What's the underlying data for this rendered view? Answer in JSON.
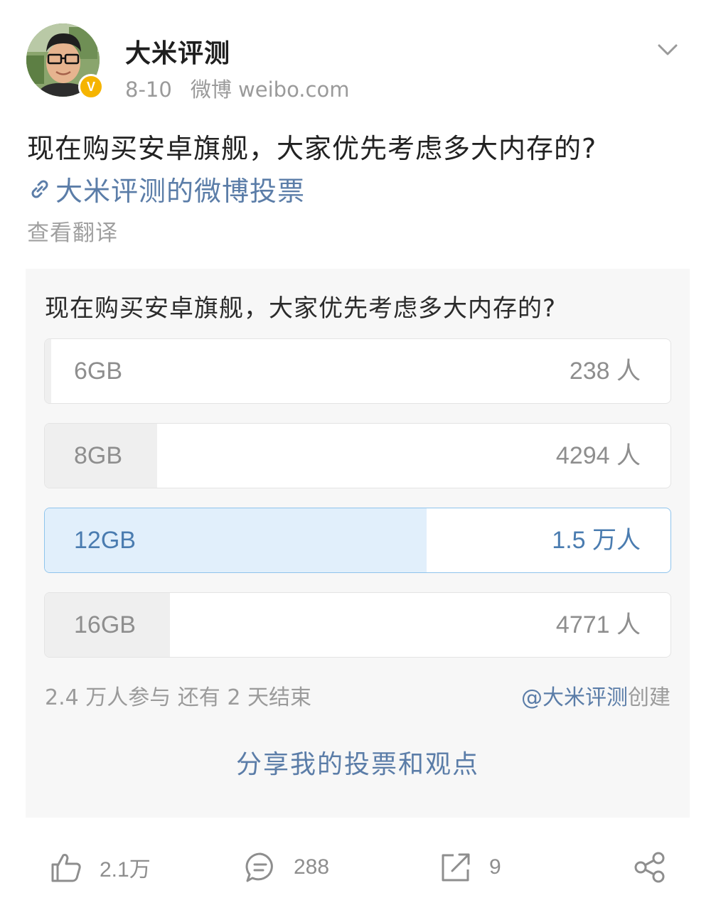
{
  "author": {
    "name": "大米评测",
    "date": "8-10",
    "source": "微博 weibo.com",
    "verified_badge": "V"
  },
  "post": {
    "text": "现在购买安卓旗舰，大家优先考虑多大内存的?",
    "poll_link": "大米评测的微博投票",
    "translate": "查看翻译"
  },
  "poll": {
    "question": "现在购买安卓旗舰，大家优先考虑多大内存的?",
    "options": [
      {
        "label": "6GB",
        "count": "238 人",
        "fraction": 0.01,
        "selected": false
      },
      {
        "label": "8GB",
        "count": "4294 人",
        "fraction": 0.18,
        "selected": false
      },
      {
        "label": "12GB",
        "count": "1.5 万人",
        "fraction": 0.61,
        "selected": true
      },
      {
        "label": "16GB",
        "count": "4771 人",
        "fraction": 0.2,
        "selected": false
      }
    ],
    "participants": "2.4 万人参与  还有 2 天结束",
    "creator": "@大米评测",
    "created_label": "创建",
    "share": "分享我的投票和观点"
  },
  "actions": {
    "likes": "2.1万",
    "comments": "288",
    "reposts": "9"
  },
  "colors": {
    "link": "#5b7da8",
    "selected_fill": "#e1effb",
    "selected_border": "#8fc4ec",
    "badge": "#f5b400"
  },
  "icons": {
    "chevron": "chevron-down-icon",
    "link": "link-icon",
    "like": "thumbs-up-icon",
    "comment": "comment-icon",
    "repost": "repost-icon",
    "share": "share-icon"
  }
}
